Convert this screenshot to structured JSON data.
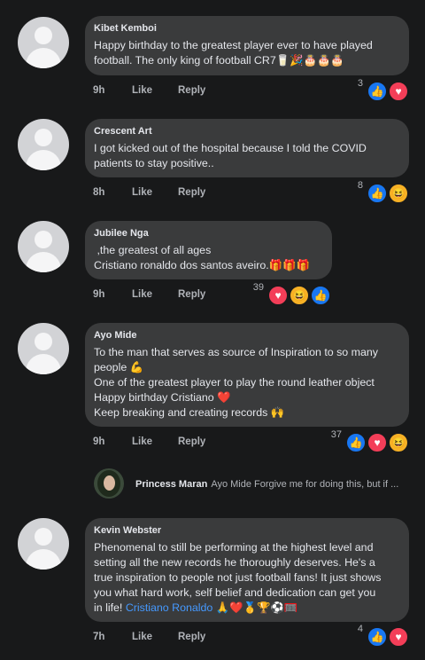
{
  "comments": [
    {
      "author": "Kibet Kemboi",
      "text": "Happy birthday to the greatest player ever to have played\nfootball. The only king of football CR7🥛🎉🎂🎂🎂",
      "time": "9h",
      "like": "Like",
      "reply": "Reply",
      "reaction_count": "3",
      "reactions": [
        "like-icon",
        "love-icon"
      ]
    },
    {
      "author": "Crescent Art",
      "text": "I got kicked out of the hospital because I told the COVID\npatients to stay positive..",
      "time": "8h",
      "like": "Like",
      "reply": "Reply",
      "reaction_count": "8",
      "reactions": [
        "like-icon",
        "haha-icon"
      ]
    },
    {
      "author": "Jubilee Nga",
      "text": " ,the greatest of all ages\nCristiano ronaldo dos santos aveiro.🎁🎁🎁",
      "time": "9h",
      "like": "Like",
      "reply": "Reply",
      "reaction_count": "39",
      "reactions": [
        "love-icon",
        "haha-icon",
        "like-icon"
      ]
    },
    {
      "author": "Ayo Mide",
      "text": "To the man that serves as source of Inspiration to so many\npeople 💪\nOne of the greatest player to play the round leather object\nHappy birthday Cristiano ❤️\nKeep breaking and creating records 🙌",
      "time": "9h",
      "like": "Like",
      "reply": "Reply",
      "reaction_count": "37",
      "reactions": [
        "like-icon",
        "love-icon",
        "haha-icon"
      ]
    },
    {
      "author": "Kevin Webster",
      "text": "Phenomenal to still be performing at the highest level and\nsetting all the new records he thoroughly deserves. He's a\ntrue inspiration to people not just football fans! It just shows\nyou what hard work, self belief and dedication can get you\nin life! ",
      "link": "Cristiano Ronaldo",
      "text_after_link": " 🙏❤️🥇🏆⚽🥅",
      "time": "7h",
      "like": "Like",
      "reply": "Reply",
      "reaction_count": "4",
      "reactions": [
        "like-icon",
        "love-icon"
      ]
    }
  ],
  "reply_preview": {
    "name": "Princess Maran",
    "text": "Ayo Mide Forgive me for doing this, but if ..."
  },
  "colors": {
    "background": "#18191a",
    "bubble": "#3a3b3c",
    "like": "#1877f2",
    "love": "#f33e58",
    "haha": "#f7b125",
    "link": "#4599ff"
  }
}
